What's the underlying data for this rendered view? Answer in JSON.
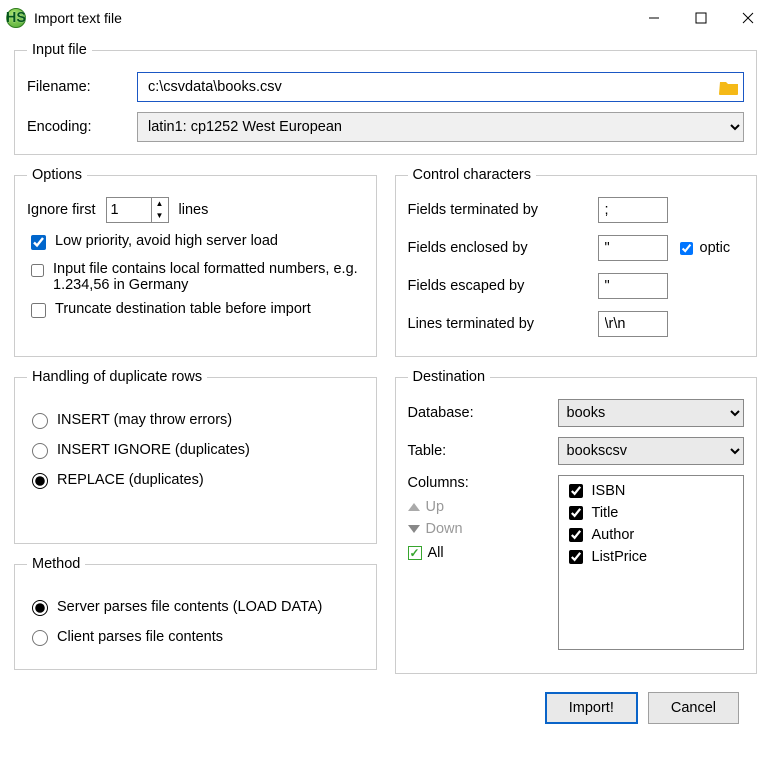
{
  "window": {
    "title": "Import text file"
  },
  "input_file": {
    "legend": "Input file",
    "filename_label": "Filename:",
    "filename_value": "c:\\csvdata\\books.csv",
    "encoding_label": "Encoding:",
    "encoding_value": "latin1: cp1252 West European"
  },
  "options": {
    "legend": "Options",
    "ignore_first_label": "Ignore first",
    "ignore_first_value": "1",
    "ignore_first_suffix": "lines",
    "low_priority": "Low priority, avoid high server load",
    "local_numbers": "Input file contains local formatted numbers, e.g. 1.234,56 in Germany",
    "truncate": "Truncate destination table before import"
  },
  "control_chars": {
    "legend": "Control characters",
    "fields_term_label": "Fields terminated by",
    "fields_term_value": ";",
    "fields_encl_label": "Fields enclosed by",
    "fields_encl_value": "\"",
    "optic_label": "optic",
    "fields_esc_label": "Fields escaped by",
    "fields_esc_value": "\"",
    "lines_term_label": "Lines terminated by",
    "lines_term_value": "\\r\\n"
  },
  "duplicates": {
    "legend": "Handling of duplicate rows",
    "insert": "INSERT (may throw errors)",
    "insert_ignore": "INSERT IGNORE (duplicates)",
    "replace": "REPLACE (duplicates)"
  },
  "method": {
    "legend": "Method",
    "server": "Server parses file contents (LOAD DATA)",
    "client": "Client parses file contents"
  },
  "destination": {
    "legend": "Destination",
    "database_label": "Database:",
    "database_value": "books",
    "table_label": "Table:",
    "table_value": "bookscsv",
    "columns_label": "Columns:",
    "up_label": "Up",
    "down_label": "Down",
    "all_label": "All",
    "columns": [
      "ISBN",
      "Title",
      "Author",
      "ListPrice"
    ]
  },
  "footer": {
    "import": "Import!",
    "cancel": "Cancel"
  }
}
